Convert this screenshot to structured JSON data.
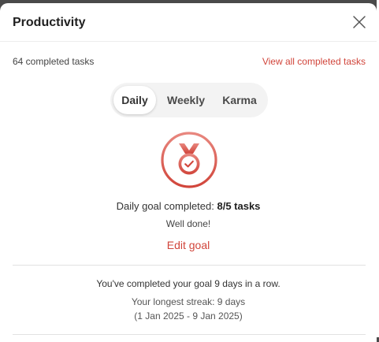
{
  "dialog": {
    "title": "Productivity",
    "close_icon": "close-icon"
  },
  "summary": {
    "completed_count": "64 completed tasks",
    "view_all_link": "View all completed tasks"
  },
  "tabs": [
    {
      "label": "Daily",
      "active": true
    },
    {
      "label": "Weekly",
      "active": false
    },
    {
      "label": "Karma",
      "active": false
    }
  ],
  "goal": {
    "medal_icon": "medal-check-icon",
    "label": "Daily goal completed: ",
    "value": "8/5 tasks",
    "message": "Well done!",
    "edit_link": "Edit goal"
  },
  "streak": {
    "current": "You've completed your goal 9 days in a row.",
    "longest": "Your longest streak: 9 days",
    "range": "(1 Jan 2025 - 9 Jan 2025)"
  },
  "colors": {
    "accent": "#d1453b",
    "medal_light": "#e8877f"
  }
}
